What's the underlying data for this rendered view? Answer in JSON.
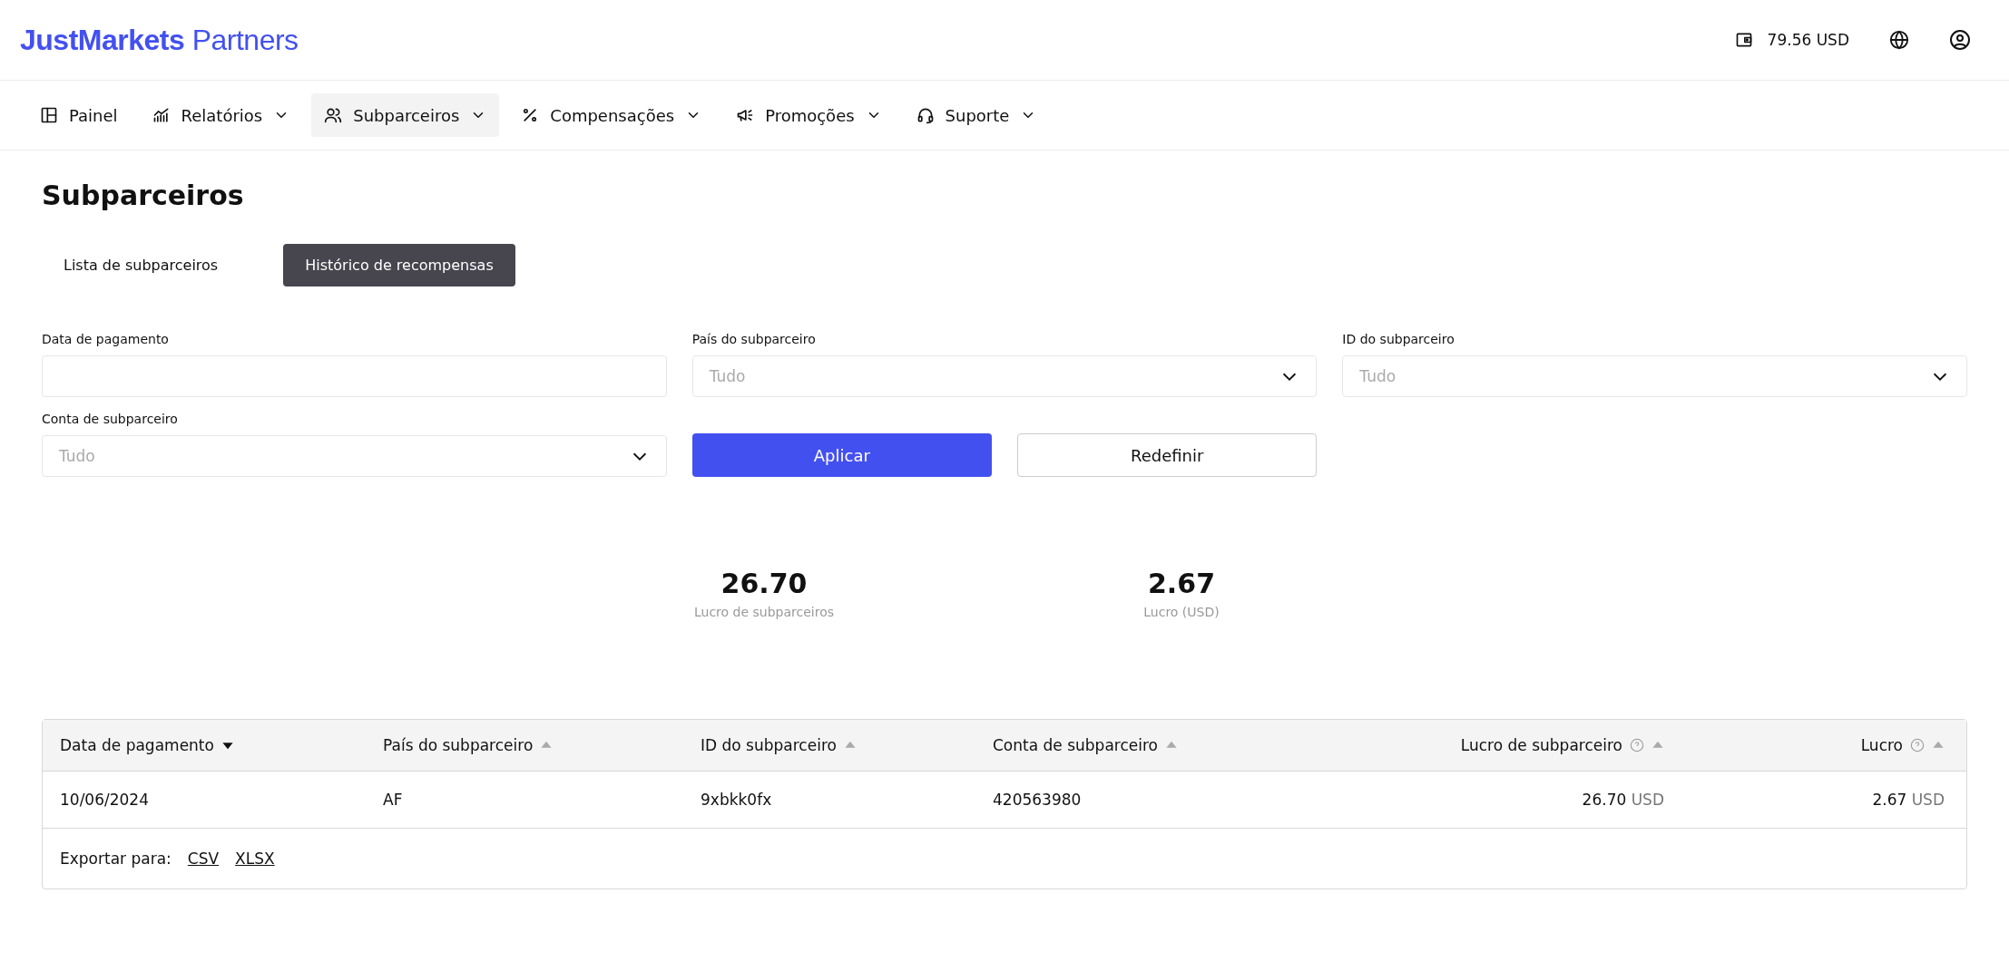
{
  "header": {
    "logo": {
      "brand": "JustMarkets",
      "suffix": "Partners"
    },
    "balance": "79.56 USD"
  },
  "nav": [
    {
      "label": "Painel",
      "dropdown": false,
      "selected": false
    },
    {
      "label": "Relatórios",
      "dropdown": true,
      "selected": false
    },
    {
      "label": "Subparceiros",
      "dropdown": true,
      "selected": true
    },
    {
      "label": "Compensações",
      "dropdown": true,
      "selected": false
    },
    {
      "label": "Promoções",
      "dropdown": true,
      "selected": false
    },
    {
      "label": "Suporte",
      "dropdown": true,
      "selected": false
    }
  ],
  "page_title": "Subparceiros",
  "tabs": [
    {
      "label": "Lista de subparceiros",
      "selected": false
    },
    {
      "label": "Histórico de recompensas",
      "selected": true
    }
  ],
  "filters": [
    {
      "label": "Data de pagamento",
      "kind": "date"
    },
    {
      "label": "País do subparceiro",
      "kind": "select",
      "placeholder": "Tudo"
    },
    {
      "label": "ID do subparceiro",
      "kind": "select",
      "placeholder": "Tudo"
    },
    {
      "label": "Conta de subparceiro",
      "kind": "select",
      "placeholder": "Tudo"
    }
  ],
  "buttons": {
    "apply": "Aplicar",
    "reset": "Redefinir"
  },
  "summary": [
    {
      "value": "26.70",
      "label": "Lucro de subparceiros"
    },
    {
      "value": "2.67",
      "label": "Lucro (USD)"
    }
  ],
  "table": {
    "columns": [
      {
        "label": "Data de pagamento",
        "sorted": true,
        "help": false,
        "kind": "text"
      },
      {
        "label": "País do subparceiro",
        "sorted": false,
        "help": false,
        "kind": "text"
      },
      {
        "label": "ID do subparceiro",
        "sorted": false,
        "help": false,
        "kind": "text"
      },
      {
        "label": "Conta de subparceiro",
        "sorted": false,
        "help": false,
        "kind": "text"
      },
      {
        "label": "Lucro de subparceiro",
        "sorted": false,
        "help": true,
        "kind": "amount"
      },
      {
        "label": "Lucro",
        "sorted": false,
        "help": true,
        "kind": "amount"
      }
    ],
    "rows": [
      [
        {
          "text": "10/06/2024"
        },
        {
          "text": "AF"
        },
        {
          "text": "9xbkk0fx"
        },
        {
          "text": "420563980"
        },
        {
          "amount": "26.70",
          "currency": "USD"
        },
        {
          "amount": "2.67",
          "currency": "USD"
        }
      ]
    ],
    "export": {
      "label": "Exportar para:",
      "links": [
        "CSV",
        "XLSX"
      ]
    }
  }
}
